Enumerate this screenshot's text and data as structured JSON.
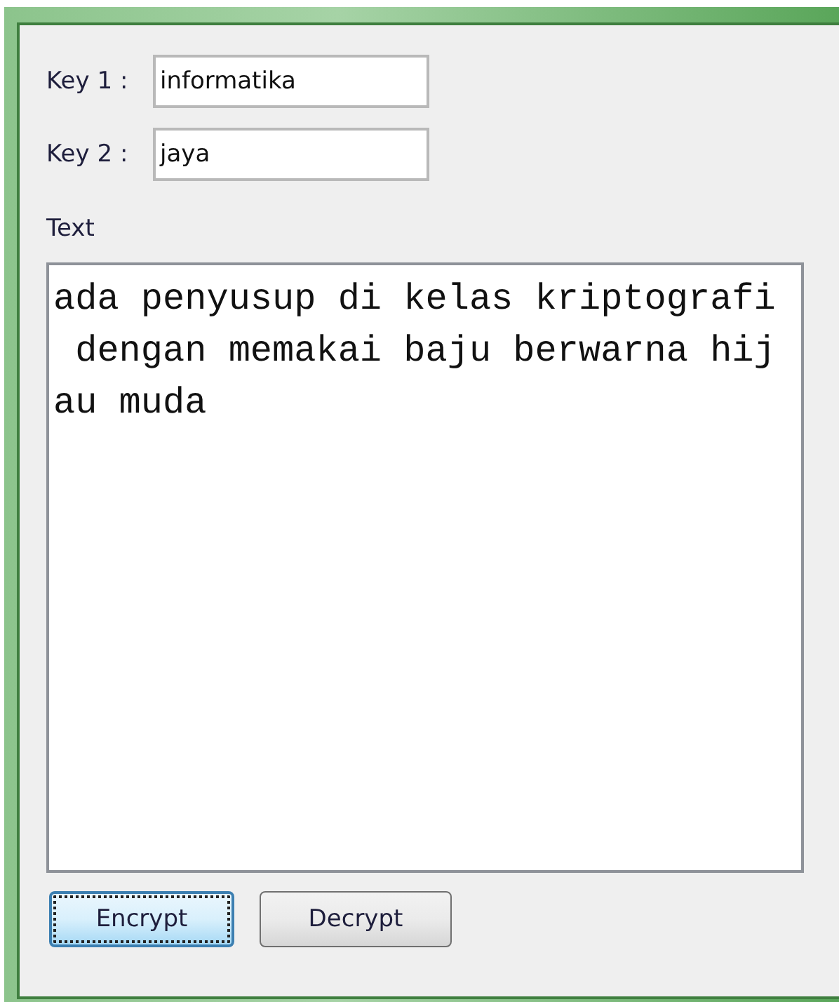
{
  "keys": [
    {
      "label": "Key 1 :",
      "value": "informatika"
    },
    {
      "label": "Key 2 :",
      "value": "jaya"
    }
  ],
  "text": {
    "label": "Text",
    "value_lines": [
      "ada penyusup di kelas kriptografi",
      " dengan memakai baju berwarna hij",
      "au muda"
    ]
  },
  "buttons": [
    {
      "label": "Encrypt",
      "focused": true
    },
    {
      "label": "Decrypt",
      "focused": false
    }
  ]
}
